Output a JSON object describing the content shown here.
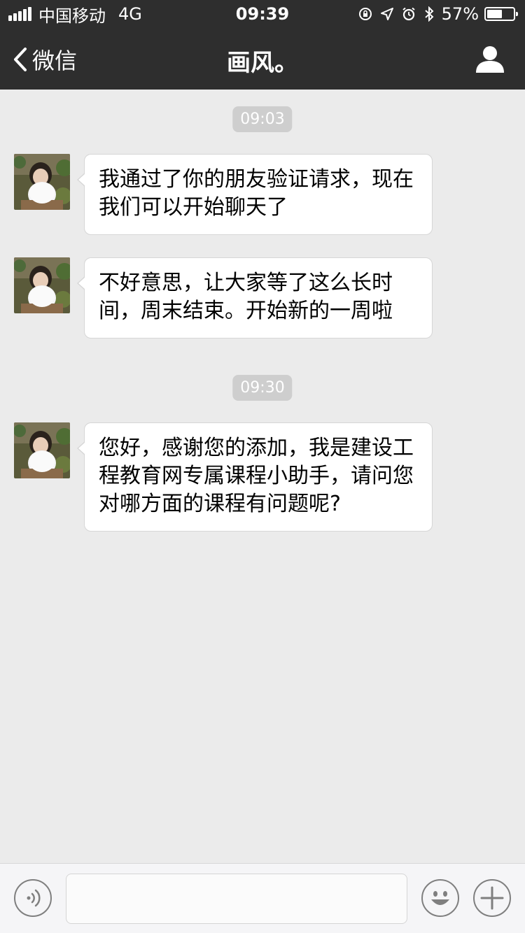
{
  "status_bar": {
    "carrier": "中国移动",
    "network": "4G",
    "time": "09:39",
    "battery": "57%",
    "battery_level": 0.57
  },
  "nav": {
    "back_label": "微信",
    "title": "画风。",
    "profile_icon": "person-icon"
  },
  "chat": {
    "groups": [
      {
        "time": "09:03",
        "messages": [
          "我通过了你的朋友验证请求，现在我们可以开始聊天了",
          "不好意思，让大家等了这么长时间，周末结束。开始新的一周啦"
        ]
      },
      {
        "time": "09:30",
        "messages": [
          "您好，感谢您的添加，我是建设工程教育网专属课程小助手，请问您对哪方面的课程有问题呢?"
        ]
      }
    ]
  },
  "input_bar": {
    "voice_icon": "voice-icon",
    "emoji_icon": "emoji-icon",
    "plus_icon": "plus-icon",
    "placeholder": ""
  },
  "colors": {
    "bar_bg": "#2e2e2e",
    "chat_bg": "#ebebeb",
    "time_pill_bg": "#cecece",
    "bubble_bg": "#ffffff"
  }
}
